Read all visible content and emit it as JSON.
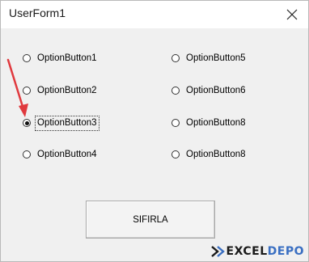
{
  "window": {
    "title": "UserForm1"
  },
  "options": {
    "left": [
      {
        "label": "OptionButton1",
        "checked": false
      },
      {
        "label": "OptionButton2",
        "checked": false
      },
      {
        "label": "OptionButton3",
        "checked": true
      },
      {
        "label": "OptionButton4",
        "checked": false
      }
    ],
    "right": [
      {
        "label": "OptionButton5",
        "checked": false
      },
      {
        "label": "OptionButton6",
        "checked": false
      },
      {
        "label": "OptionButton8",
        "checked": false
      },
      {
        "label": "OptionButton8",
        "checked": false
      }
    ]
  },
  "reset_button": {
    "label": "SIFIRLA"
  },
  "watermark": {
    "text_main": "EXCEL",
    "text_accent": "DEPO"
  },
  "colors": {
    "arrow": "#e0393e",
    "logo_accent": "#3a6fc2"
  }
}
